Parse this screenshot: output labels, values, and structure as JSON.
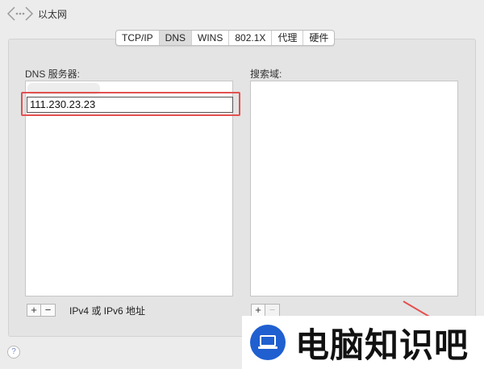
{
  "window": {
    "title": "以太网"
  },
  "tabs": [
    {
      "label": "TCP/IP",
      "selected": false
    },
    {
      "label": "DNS",
      "selected": true
    },
    {
      "label": "WINS",
      "selected": false
    },
    {
      "label": "802.1X",
      "selected": false
    },
    {
      "label": "代理",
      "selected": false
    },
    {
      "label": "硬件",
      "selected": false
    }
  ],
  "dns": {
    "label": "DNS 服务器:",
    "entries": [
      "111.230.23.23"
    ],
    "add_label": "+",
    "remove_label": "−",
    "address_hint": "IPv4 或 IPv6 地址"
  },
  "search": {
    "label": "搜索域:",
    "add_label": "+",
    "remove_label": "−"
  },
  "help": {
    "label": "?"
  },
  "watermark": {
    "text": "电脑知识吧",
    "logo_icon": "laptop-icon",
    "logo_color": "#1f5fd0"
  },
  "colors": {
    "highlight": "#e35050",
    "selected_tab": "#dcdcdc"
  }
}
